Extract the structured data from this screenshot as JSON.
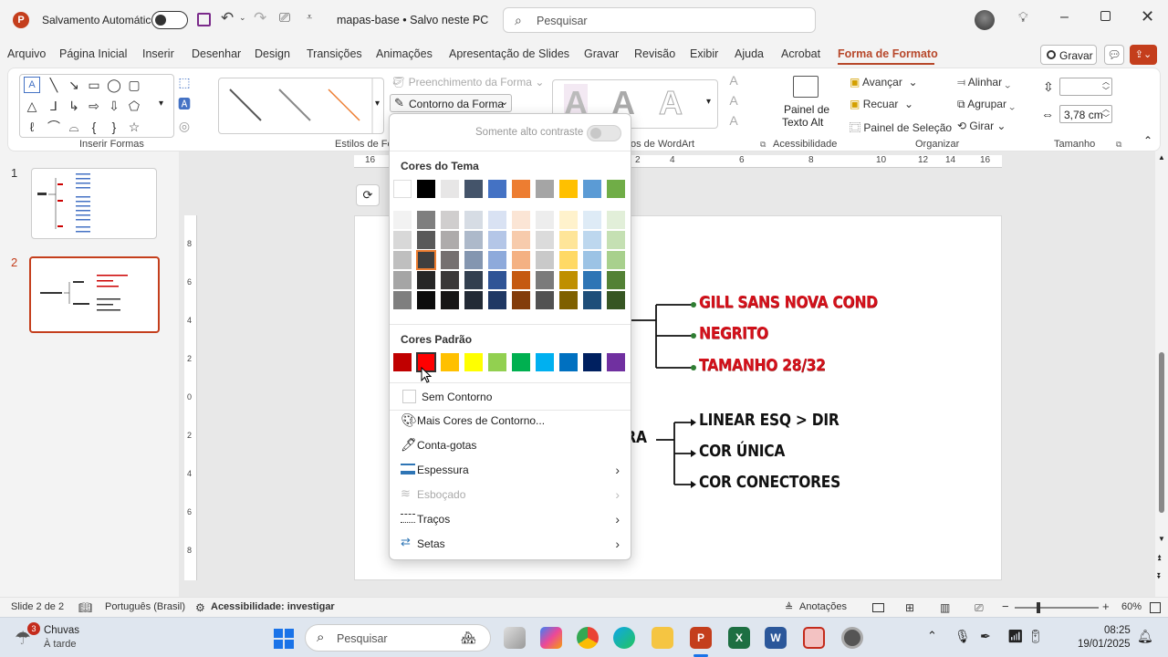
{
  "titlebar": {
    "autosave_label": "Salvamento Automático",
    "doc_title": "mapas-base • Salvo neste PC",
    "search_placeholder": "Pesquisar"
  },
  "menu": [
    "Arquivo",
    "Página Inicial",
    "Inserir",
    "Desenhar",
    "Design",
    "Transições",
    "Animações",
    "Apresentação de Slides",
    "Gravar",
    "Revisão",
    "Exibir",
    "Ajuda",
    "Acrobat",
    "Forma de Formato"
  ],
  "menu_active_index": 13,
  "gravar_button": "Gravar",
  "ribbon": {
    "groups": {
      "insert_shapes": "Inserir Formas",
      "shape_styles": "Estilos de Fo",
      "wordart": "os de WordArt",
      "accessibility": "Acessibilidade",
      "organize": "Organizar",
      "size": "Tamanho"
    },
    "fill_label": "Preenchimento da Forma",
    "outline_label": "Contorno da Forma",
    "alt_text_line1": "Painel de",
    "alt_text_line2": "Texto Alt",
    "bring_forward": "Avançar",
    "send_backward": "Recuar",
    "selection_pane": "Painel de Seleção",
    "align": "Alinhar",
    "group": "Agrupar",
    "rotate": "Girar",
    "height_value": "",
    "width_value": "3,78 cm",
    "wordart_letter": "A"
  },
  "ruler": {
    "h_ticks_left": [
      "16"
    ],
    "h_ticks_right": [
      "2",
      "4",
      "6",
      "8",
      "10",
      "12",
      "14",
      "16"
    ],
    "v_ticks": [
      "8",
      "6",
      "4",
      "2",
      "0",
      "2",
      "4",
      "6",
      "8"
    ]
  },
  "slides_panel": [
    {
      "number": "1"
    },
    {
      "number": "2"
    }
  ],
  "slide": {
    "red_items": [
      "GILL SANS NOVA COND",
      "NEGRITO",
      "TAMANHO 28/32"
    ],
    "partial_label": "URA",
    "black_items": [
      "LINEAR ESQ > DIR",
      "COR ÚNICA",
      "COR CONECTORES"
    ]
  },
  "dropdown": {
    "high_contrast_label": "Somente alto contraste",
    "theme_colors_title": "Cores do Tema",
    "theme_top": [
      "#ffffff",
      "#000000",
      "#e7e6e6",
      "#44546a",
      "#4472c4",
      "#ed7d31",
      "#a5a5a5",
      "#ffc000",
      "#5b9bd5",
      "#70ad47"
    ],
    "theme_shades": [
      [
        "#f2f2f2",
        "#7f7f7f",
        "#d0cece",
        "#d6dce4",
        "#d9e2f3",
        "#fbe5d5",
        "#ededed",
        "#fff2cc",
        "#deebf6",
        "#e2efd9"
      ],
      [
        "#d8d8d8",
        "#595959",
        "#aeabab",
        "#adb9ca",
        "#b4c6e7",
        "#f7cbac",
        "#dbdbdb",
        "#fee599",
        "#bdd7ee",
        "#c5e0b3"
      ],
      [
        "#bfbfbf",
        "#3f3f3f",
        "#757070",
        "#8496b0",
        "#8eaadb",
        "#f4b183",
        "#c9c9c9",
        "#ffd965",
        "#9cc3e5",
        "#a8d08d"
      ],
      [
        "#a5a5a5",
        "#262626",
        "#3a3838",
        "#323f4f",
        "#2f5496",
        "#c55a11",
        "#7b7b7b",
        "#bf8f00",
        "#2e75b5",
        "#538135"
      ],
      [
        "#7f7f7f",
        "#0c0c0c",
        "#171616",
        "#222a35",
        "#1f3864",
        "#833c0b",
        "#525252",
        "#7f6000",
        "#1e4e79",
        "#375623"
      ]
    ],
    "standard_colors_title": "Cores Padrão",
    "standard_colors": [
      "#c00000",
      "#ff0000",
      "#ffc000",
      "#ffff00",
      "#92d050",
      "#00b050",
      "#00b0f0",
      "#0070c0",
      "#002060",
      "#7030a0"
    ],
    "no_outline": "Sem Contorno",
    "more_colors": "Mais Cores de Contorno...",
    "eyedropper": "Conta-gotas",
    "weight": "Espessura",
    "sketched": "Esboçado",
    "dashes": "Traços",
    "arrows": "Setas"
  },
  "status": {
    "slide_info": "Slide 2 de 2",
    "language": "Português (Brasil)",
    "accessibility": "Acessibilidade: investigar",
    "notes": "Anotações",
    "zoom": "60%"
  },
  "taskbar": {
    "weather_badge": "3",
    "weather_title": "Chuvas",
    "weather_sub": "À tarde",
    "search_placeholder": "Pesquisar",
    "time": "08:25",
    "date": "19/01/2025"
  }
}
